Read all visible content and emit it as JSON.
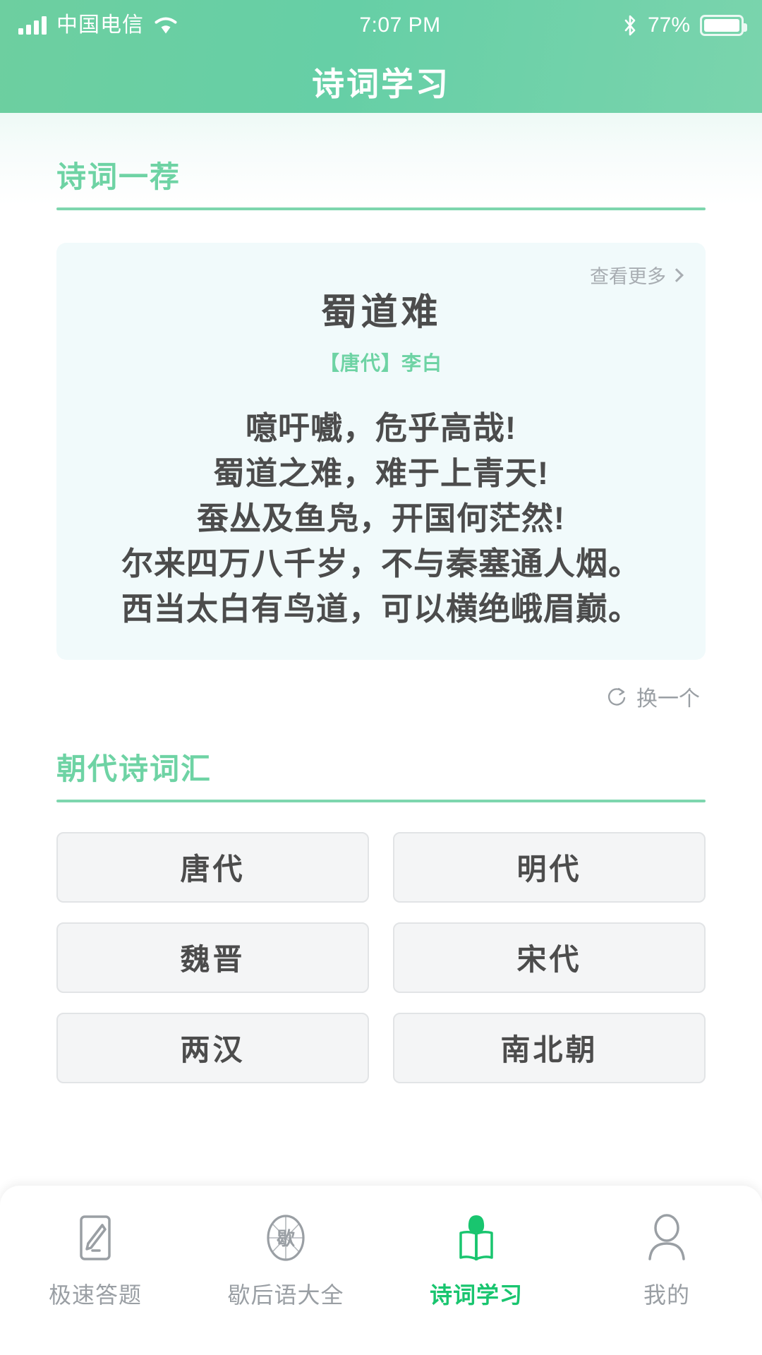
{
  "status_bar": {
    "carrier": "中国电信",
    "time": "7:07 PM",
    "battery_pct": "77%",
    "icons": [
      "signal-bars-icon",
      "wifi-icon",
      "bluetooth-icon",
      "battery-icon"
    ]
  },
  "header": {
    "title": "诗词学习",
    "accent_color": "#6ed3a4"
  },
  "recommend_section": {
    "title": "诗词一荐",
    "more_label": "查看更多",
    "refresh_label": "换一个",
    "poem": {
      "title": "蜀道难",
      "author": "【唐代】李白",
      "lines": [
        "噫吁嚱，危乎高哉!",
        "蜀道之难，难于上青天!",
        "蚕丛及鱼凫，开国何茫然!",
        "尔来四万八千岁，不与秦塞通人烟。",
        "西当太白有鸟道，可以横绝峨眉巅。"
      ]
    }
  },
  "dynasty_section": {
    "title": "朝代诗词汇",
    "items": [
      "唐代",
      "明代",
      "魏晋",
      "宋代",
      "两汉",
      "南北朝"
    ]
  },
  "tab_bar": {
    "tabs": [
      {
        "label": "极速答题",
        "icon": "quiz-pencil-icon",
        "active": false
      },
      {
        "label": "歇后语大全",
        "icon": "xiehouyu-emblem-icon",
        "active": false
      },
      {
        "label": "诗词学习",
        "icon": "open-book-icon",
        "active": true
      },
      {
        "label": "我的",
        "icon": "person-icon",
        "active": false
      }
    ],
    "active_color": "#19c56f",
    "inactive_color": "#9a9fa4"
  }
}
